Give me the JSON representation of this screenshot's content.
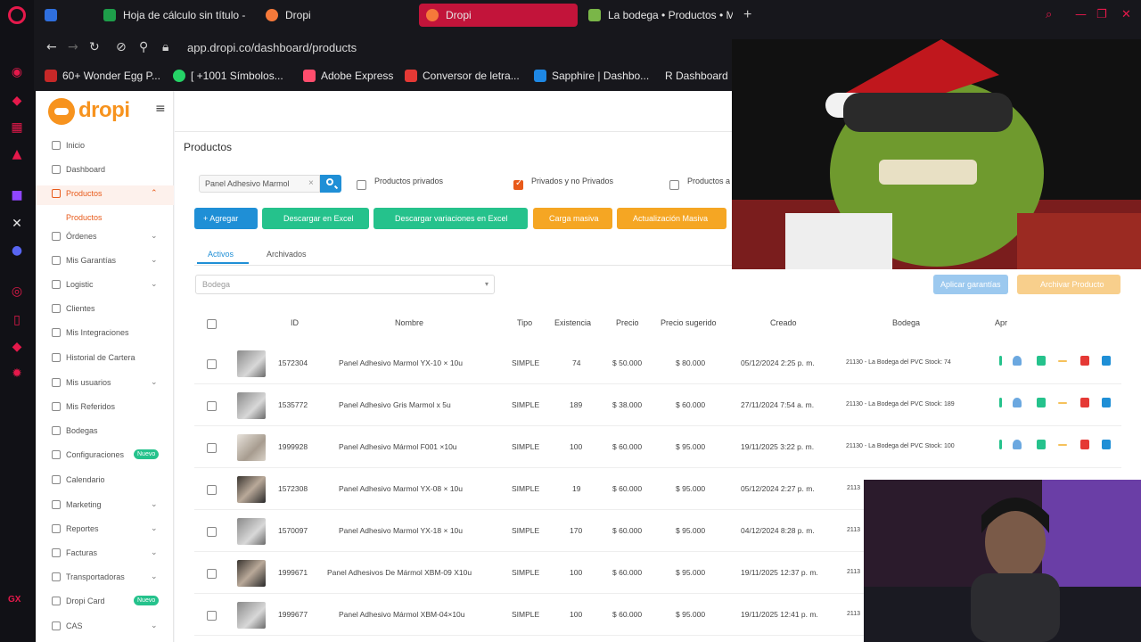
{
  "browser": {
    "tabs": [
      {
        "label": "Hoja de cálculo sin título -",
        "fav": "#1e9e4a"
      },
      {
        "label": "Dropi",
        "fav": "#f5793a"
      },
      {
        "label": "Dropi",
        "fav": "#f5793a"
      },
      {
        "label": "La bodega • Productos • M",
        "fav": "#7ab648"
      }
    ],
    "url_host": "app.dropi.co",
    "url_path": "/dashboard/products",
    "bookmarks": [
      {
        "label": "60+ Wonder Egg P...",
        "fav": "#c62828"
      },
      {
        "label": "[ +1001 Símbolos...",
        "fav": "#25d366"
      },
      {
        "label": "Adobe Express",
        "fav": "#ff4d6d"
      },
      {
        "label": "Conversor de letra...",
        "fav": "#e53935"
      },
      {
        "label": "Sapphire | Dashbo...",
        "fav": "#1e88e5"
      },
      {
        "label": "R  Dashboard",
        "fav": "#17171c"
      }
    ],
    "gx_label": "GX"
  },
  "brand": {
    "name": "dropi"
  },
  "sidebar": {
    "items": [
      {
        "label": "Inicio",
        "chev": ""
      },
      {
        "label": "Dashboard",
        "chev": ""
      },
      {
        "label": "Productos",
        "chev": "⌃"
      },
      {
        "label": "Órdenes",
        "chev": "⌄"
      },
      {
        "label": "Mis Garantías",
        "chev": "⌄"
      },
      {
        "label": "Logistic",
        "chev": "⌄"
      },
      {
        "label": "Clientes",
        "chev": ""
      },
      {
        "label": "Mis Integraciones",
        "chev": ""
      },
      {
        "label": "Historial de Cartera",
        "chev": ""
      },
      {
        "label": "Mis usuarios",
        "chev": "⌄"
      },
      {
        "label": "Mis Referidos",
        "chev": ""
      },
      {
        "label": "Bodegas",
        "chev": ""
      },
      {
        "label": "Configuraciones",
        "chev": "",
        "badge": "Nuevo"
      },
      {
        "label": "Calendario",
        "chev": ""
      },
      {
        "label": "Marketing",
        "chev": "⌄"
      },
      {
        "label": "Reportes",
        "chev": "⌄"
      },
      {
        "label": "Facturas",
        "chev": "⌄"
      },
      {
        "label": "Transportadoras",
        "chev": "⌄"
      },
      {
        "label": "Dropi Card",
        "chev": "",
        "badge": "Nuevo"
      },
      {
        "label": "CAS",
        "chev": "⌄"
      }
    ],
    "sub_item": "Productos"
  },
  "main": {
    "title": "Productos",
    "search_value": "Panel Adhesivo Marmol",
    "filters": {
      "privados": "Productos privados",
      "ambos": "Privados y no Privados",
      "otro": "Productos a"
    },
    "buttons": {
      "agregar": "+  Agregar",
      "descargar": "Descargar en Excel",
      "variaciones": "Descargar variaciones en Excel",
      "carga": "Carga masiva",
      "actualizacion": "Actualización Masiva",
      "aplicar": "Aplicar garantías",
      "archivar": "Archivar Producto"
    },
    "tabs": {
      "activos": "Activos",
      "archivados": "Archivados"
    },
    "bodega_placeholder": "Bodega"
  },
  "table": {
    "headers": {
      "id": "ID",
      "nombre": "Nombre",
      "tipo": "Tipo",
      "existencia": "Existencia",
      "precio": "Precio",
      "sugerido": "Precio sugerido",
      "creado": "Creado",
      "bodega": "Bodega",
      "apr": "Apr"
    },
    "rows": [
      {
        "id": "1572304",
        "nombre": "Panel Adhesivo Marmol YX-10 × 10u",
        "tipo": "SIMPLE",
        "existencia": "74",
        "precio": "$ 50.000",
        "sugerido": "$ 80.000",
        "creado": "05/12/2024 2:25 p. m.",
        "bodega": "21130 - La Bodega del PVC Stock: 74"
      },
      {
        "id": "1535772",
        "nombre": "Panel Adhesivo Gris Marmol x 5u",
        "tipo": "SIMPLE",
        "existencia": "189",
        "precio": "$ 38.000",
        "sugerido": "$ 60.000",
        "creado": "27/11/2024 7:54 a. m.",
        "bodega": "21130 - La Bodega del PVC Stock: 189"
      },
      {
        "id": "1999928",
        "nombre": "Panel Adhesivo Mármol F001 ×10u",
        "tipo": "SIMPLE",
        "existencia": "100",
        "precio": "$ 60.000",
        "sugerido": "$ 95.000",
        "creado": "19/11/2025 3:22 p. m.",
        "bodega": "21130 - La Bodega del PVC Stock: 100"
      },
      {
        "id": "1572308",
        "nombre": "Panel Adhesivo Marmol YX-08 × 10u",
        "tipo": "SIMPLE",
        "existencia": "19",
        "precio": "$ 60.000",
        "sugerido": "$ 95.000",
        "creado": "05/12/2024 2:27 p. m.",
        "bodega": "2113"
      },
      {
        "id": "1570097",
        "nombre": "Panel Adhesivo Marmol YX-18 × 10u",
        "tipo": "SIMPLE",
        "existencia": "170",
        "precio": "$ 60.000",
        "sugerido": "$ 95.000",
        "creado": "04/12/2024 8:28 p. m.",
        "bodega": "2113"
      },
      {
        "id": "1999671",
        "nombre": "Panel Adhesivos De Mármol XBM-09 X10u",
        "tipo": "SIMPLE",
        "existencia": "100",
        "precio": "$ 60.000",
        "sugerido": "$ 95.000",
        "creado": "19/11/2025 12:37 p. m.",
        "bodega": "2113"
      },
      {
        "id": "1999677",
        "nombre": "Panel Adhesivo Mármol XBM-04×10u",
        "tipo": "SIMPLE",
        "existencia": "100",
        "precio": "$ 60.000",
        "sugerido": "$ 95.000",
        "creado": "19/11/2025 12:41 p. m.",
        "bodega": "2113"
      }
    ]
  }
}
